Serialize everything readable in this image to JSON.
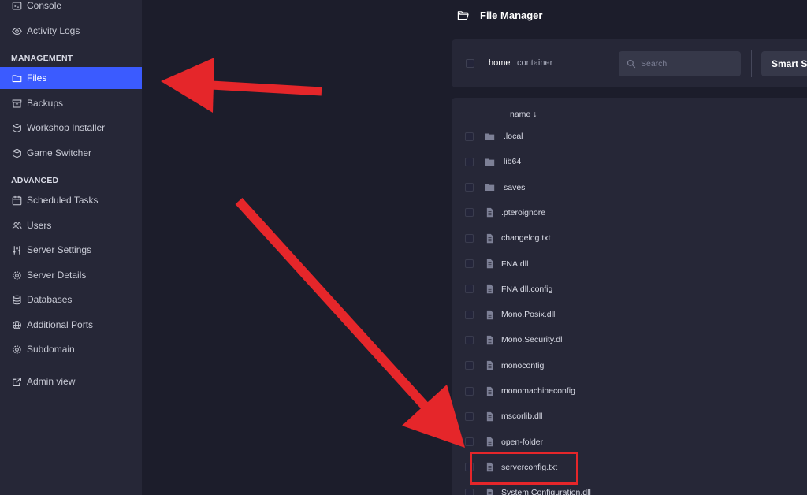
{
  "sidebar": {
    "items": [
      {
        "label": "Console",
        "icon": "terminal-icon"
      },
      {
        "label": "Activity Logs",
        "icon": "eye-icon"
      },
      {
        "label": "Files",
        "icon": "folder-icon",
        "active": true
      },
      {
        "label": "Backups",
        "icon": "archive-icon"
      },
      {
        "label": "Workshop Installer",
        "icon": "cube-icon"
      },
      {
        "label": "Game Switcher",
        "icon": "cube-icon"
      },
      {
        "label": "Scheduled Tasks",
        "icon": "calendar-icon"
      },
      {
        "label": "Users",
        "icon": "users-icon"
      },
      {
        "label": "Server Settings",
        "icon": "sliders-icon"
      },
      {
        "label": "Server Details",
        "icon": "gear-icon"
      },
      {
        "label": "Databases",
        "icon": "database-icon"
      },
      {
        "label": "Additional Ports",
        "icon": "globe-icon"
      },
      {
        "label": "Subdomain",
        "icon": "gear-icon"
      },
      {
        "label": "Admin view",
        "icon": "external-link-icon"
      }
    ],
    "sections": {
      "management": "MANAGEMENT",
      "advanced": "ADVANCED"
    }
  },
  "header": {
    "title": "File Manager"
  },
  "toolbar": {
    "breadcrumb": [
      "home",
      "container"
    ],
    "search_placeholder": "Search",
    "smart_button_label": "Smart Se"
  },
  "file_list": {
    "column_header": "name ↓",
    "rows": [
      {
        "name": ".local",
        "type": "folder"
      },
      {
        "name": "lib64",
        "type": "folder"
      },
      {
        "name": "saves",
        "type": "folder"
      },
      {
        "name": ".pteroignore",
        "type": "file"
      },
      {
        "name": "changelog.txt",
        "type": "file"
      },
      {
        "name": "FNA.dll",
        "type": "file"
      },
      {
        "name": "FNA.dll.config",
        "type": "file"
      },
      {
        "name": "Mono.Posix.dll",
        "type": "file"
      },
      {
        "name": "Mono.Security.dll",
        "type": "file"
      },
      {
        "name": "monoconfig",
        "type": "file"
      },
      {
        "name": "monomachineconfig",
        "type": "file"
      },
      {
        "name": "mscorlib.dll",
        "type": "file"
      },
      {
        "name": "open-folder",
        "type": "file"
      },
      {
        "name": "serverconfig.txt",
        "type": "file",
        "highlighted": true
      },
      {
        "name": "System.Configuration.dll",
        "type": "file"
      }
    ]
  },
  "colors": {
    "accent": "#3b5bff",
    "annotation": "#e5262a",
    "sidebar_bg": "#262737",
    "page_bg": "#1c1d2b"
  }
}
